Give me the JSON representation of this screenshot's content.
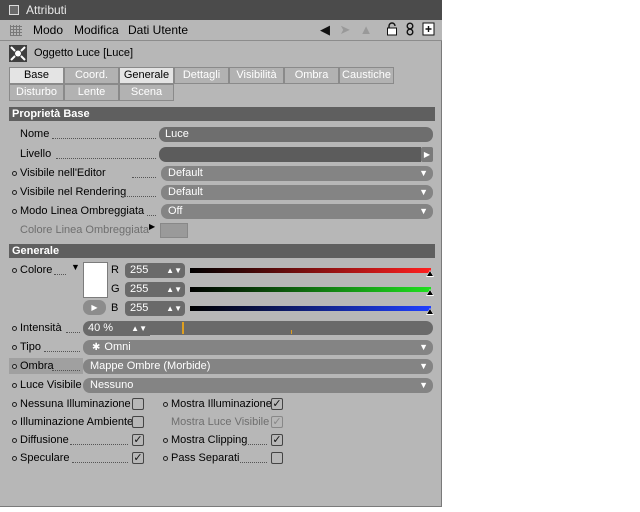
{
  "window": {
    "title": "Attributi"
  },
  "menu": {
    "items": [
      "Modo",
      "Modifica",
      "Dati Utente"
    ],
    "icons": [
      "back-arrow-icon",
      "forward-arrow-icon",
      "up-arrow-icon",
      "lock-icon",
      "link-icon",
      "new-panel-icon"
    ]
  },
  "object": {
    "name": "Oggetto Luce [Luce]",
    "icon": "light-object-icon"
  },
  "tabs": {
    "row1": [
      "Base",
      "Coord.",
      "Generale",
      "Dettagli",
      "Visibilità",
      "Ombra",
      "Caustiche"
    ],
    "row2": [
      "Disturbo",
      "Lente",
      "Scena"
    ],
    "selected": [
      "Base",
      "Generale"
    ]
  },
  "sections": {
    "base": "Proprietà Base",
    "general": "Generale"
  },
  "base": {
    "name_label": "Nome",
    "name_value": "Luce",
    "layer_label": "Livello",
    "layer_value": "",
    "vis_editor_label": "Visibile nell'Editor",
    "vis_editor_value": "Default",
    "vis_render_label": "Visibile nel Rendering",
    "vis_render_value": "Default",
    "shadow_line_label": "Modo Linea Ombreggiata",
    "shadow_line_value": "Off",
    "shadow_line_color_label": "Colore Linea Ombreggiata"
  },
  "general": {
    "color_label": "Colore",
    "color_hex": "#ffffff",
    "r_label": "R",
    "r_value": "255",
    "g_label": "G",
    "g_value": "255",
    "b_label": "B",
    "b_value": "255",
    "intensity_label": "Intensità",
    "intensity_value": "40 %",
    "intensity_fraction": 0.4,
    "type_label": "Tipo",
    "type_value": "Omni",
    "shadow_label": "Ombra",
    "shadow_value": "Mappe Ombre (Morbide)",
    "visible_light_label": "Luce Visibile",
    "visible_light_value": "Nessuno",
    "checks": {
      "no_illumination": {
        "label": "Nessuna Illuminazione",
        "checked": false
      },
      "ambient": {
        "label": "Illuminazione Ambiente",
        "checked": false
      },
      "diffuse": {
        "label": "Diffusione",
        "checked": true
      },
      "specular": {
        "label": "Speculare",
        "checked": true
      },
      "show_illumination": {
        "label": "Mostra Illuminazione",
        "checked": true
      },
      "show_visible_light": {
        "label": "Mostra Luce Visibile",
        "checked": true
      },
      "show_clipping": {
        "label": "Mostra Clipping",
        "checked": true
      },
      "separate_pass": {
        "label": "Pass Separati",
        "checked": false
      }
    }
  },
  "colors": {
    "red": "#ff2020",
    "green": "#20e020",
    "blue": "#2040ff",
    "intensity_marker": "#e0a020"
  }
}
